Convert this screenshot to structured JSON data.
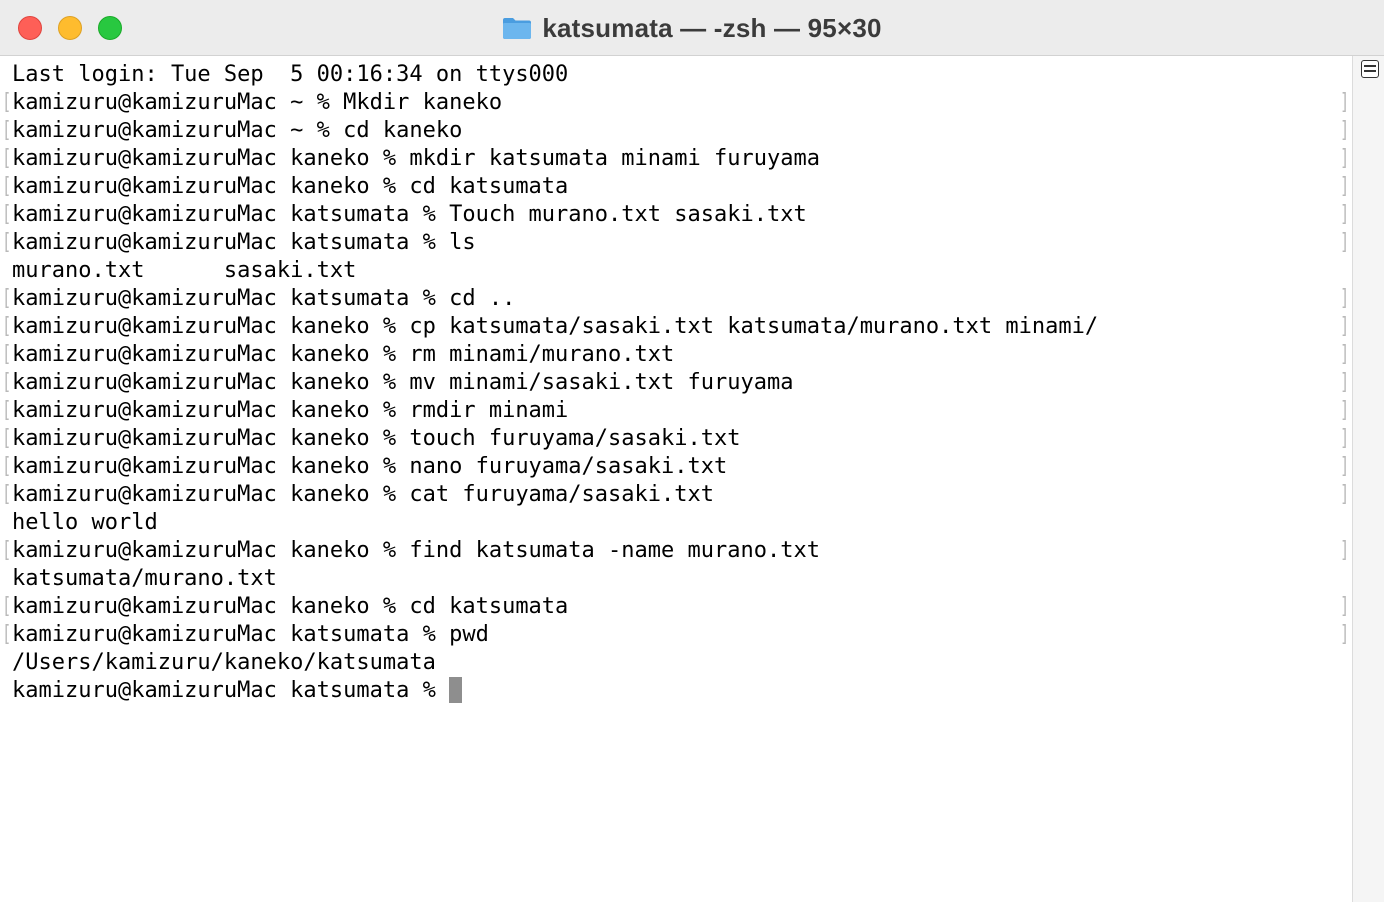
{
  "window": {
    "title": "katsumata — -zsh — 95×30",
    "title_icon": "folder-icon",
    "colors": {
      "close": "#fe5f57",
      "minimize": "#febc2e",
      "maximize": "#28c840",
      "background": "#ffffff",
      "text": "#000000",
      "cursor": "#8e8e8e",
      "folder": "#5aa9e6"
    }
  },
  "terminal": {
    "lines": [
      {
        "text": "Last login: Tue Sep  5 00:16:34 on ttys000",
        "marked": false
      },
      {
        "text": "kamizuru@kamizuruMac ~ % Mkdir kaneko",
        "marked": true
      },
      {
        "text": "kamizuru@kamizuruMac ~ % cd kaneko",
        "marked": true
      },
      {
        "text": "kamizuru@kamizuruMac kaneko % mkdir katsumata minami furuyama",
        "marked": true
      },
      {
        "text": "kamizuru@kamizuruMac kaneko % cd katsumata",
        "marked": true
      },
      {
        "text": "kamizuru@kamizuruMac katsumata % Touch murano.txt sasaki.txt",
        "marked": true
      },
      {
        "text": "kamizuru@kamizuruMac katsumata % ls",
        "marked": true
      },
      {
        "text": "murano.txt      sasaki.txt",
        "marked": false
      },
      {
        "text": "kamizuru@kamizuruMac katsumata % cd ..",
        "marked": true
      },
      {
        "text": "kamizuru@kamizuruMac kaneko % cp katsumata/sasaki.txt katsumata/murano.txt minami/",
        "marked": true
      },
      {
        "text": "kamizuru@kamizuruMac kaneko % rm minami/murano.txt",
        "marked": true
      },
      {
        "text": "kamizuru@kamizuruMac kaneko % mv minami/sasaki.txt furuyama",
        "marked": true
      },
      {
        "text": "kamizuru@kamizuruMac kaneko % rmdir minami",
        "marked": true
      },
      {
        "text": "kamizuru@kamizuruMac kaneko % touch furuyama/sasaki.txt",
        "marked": true
      },
      {
        "text": "kamizuru@kamizuruMac kaneko % nano furuyama/sasaki.txt",
        "marked": true
      },
      {
        "text": "kamizuru@kamizuruMac kaneko % cat furuyama/sasaki.txt",
        "marked": true
      },
      {
        "text": "hello world",
        "marked": false
      },
      {
        "text": "kamizuru@kamizuruMac kaneko % find katsumata -name murano.txt",
        "marked": true
      },
      {
        "text": "katsumata/murano.txt",
        "marked": false
      },
      {
        "text": "kamizuru@kamizuruMac kaneko % cd katsumata",
        "marked": true
      },
      {
        "text": "kamizuru@kamizuruMac katsumata % pwd",
        "marked": true
      },
      {
        "text": "/Users/kamizuru/kaneko/katsumata",
        "marked": false
      }
    ],
    "prompt": "kamizuru@kamizuruMac katsumata % "
  }
}
